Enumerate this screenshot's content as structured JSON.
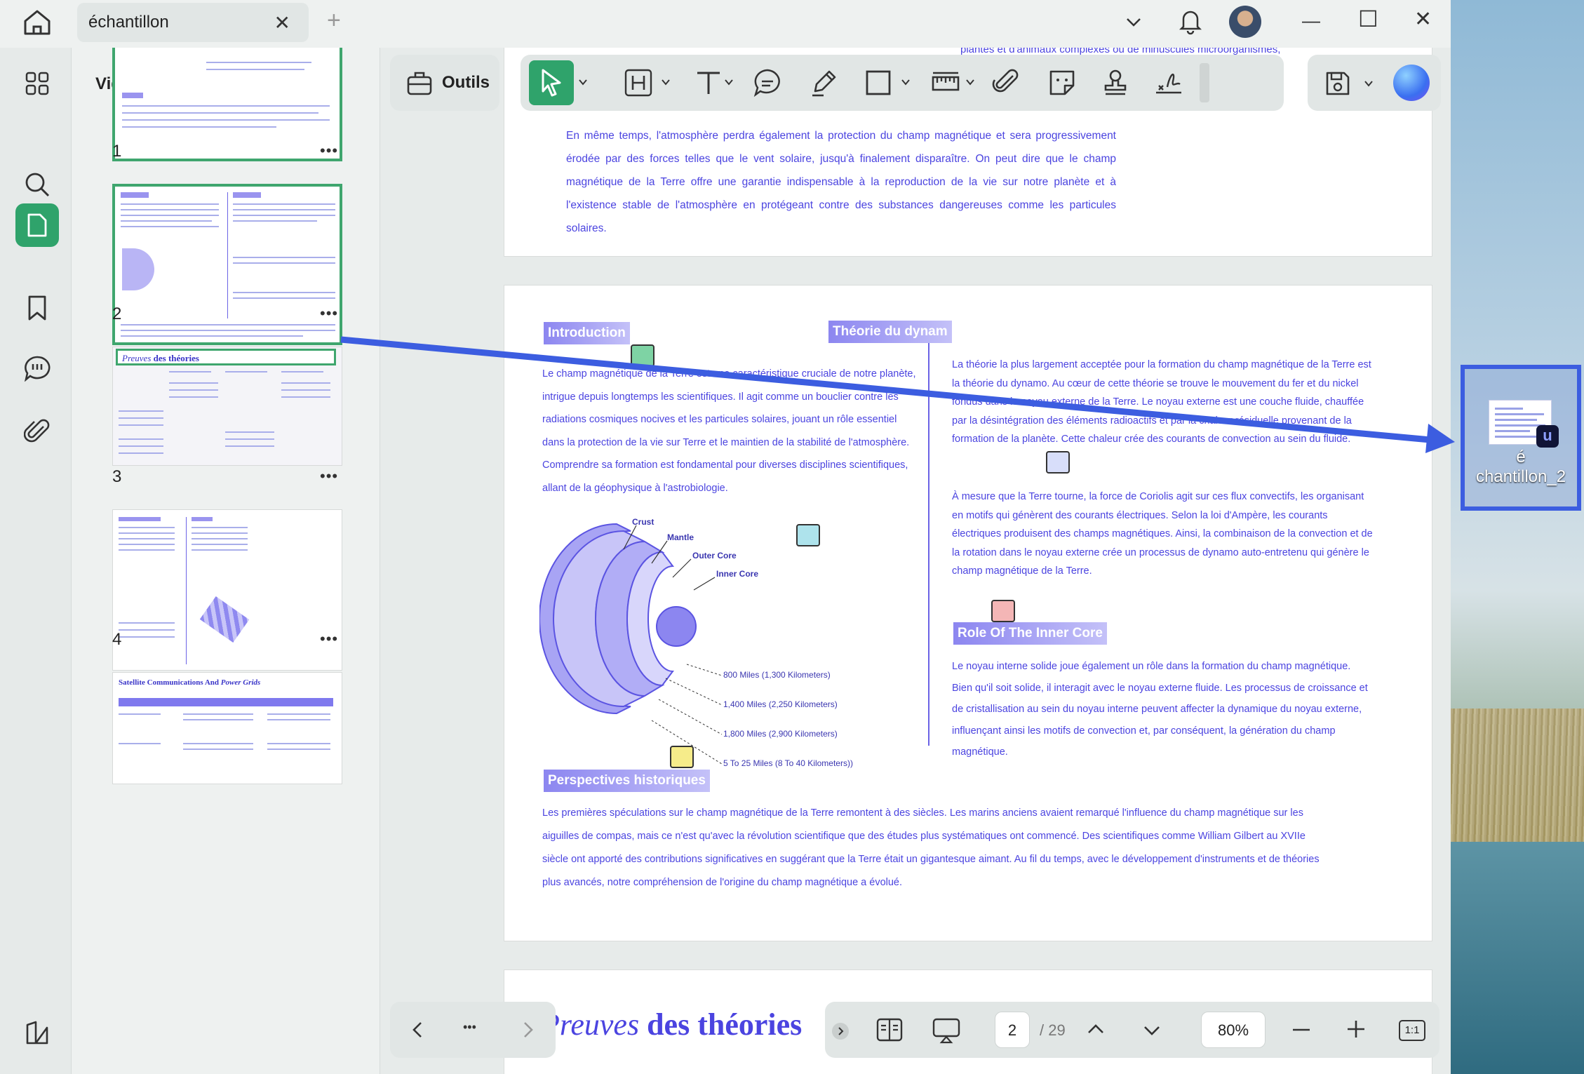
{
  "window": {
    "tab_title": "échantillon",
    "tab_close": "✕",
    "new_tab": "+",
    "controls": {
      "minimize": "—",
      "maximize": "☐",
      "close": "✕"
    }
  },
  "thumbnails": {
    "title": "Vignettes",
    "pages": [
      {
        "number": "1",
        "more": "•••"
      },
      {
        "number": "2",
        "more": "•••"
      },
      {
        "number": "3",
        "more": "•••",
        "heading_italic": "Preuves",
        "heading_rest": " des théories"
      },
      {
        "number": "4",
        "more": "•••"
      },
      {
        "number": "",
        "heading_rest": "Satellite Communications And ",
        "heading_italic": "Power Grids"
      }
    ]
  },
  "toolbar": {
    "tools_label": "Outils"
  },
  "document": {
    "page1_paragraph": "En même temps, l'atmosphère perdra également la protection du champ magnétique et sera progressivement érodée par des forces telles que le vent solaire, jusqu'à finalement disparaître. On peut dire que le champ magnétique de la Terre offre une garantie indispensable à la reproduction de la vie sur notre planète et à l'existence stable de l'atmosphère en protégeant contre des substances dangereuses comme les particules solaires.",
    "page1_top_line": "plantes et d'animaux complexes ou de minuscules microorganismes,",
    "page1_top_fragment": "et",
    "page2": {
      "intro_heading": "Introduction",
      "intro_text": "Le champ magnétique de la Terre est une caractéristique cruciale de notre planète, intrigue depuis longtemps les scientifiques. Il agit comme un bouclier contre les radiations cosmiques nocives et les particules solaires, jouant un rôle essentiel dans la protection de la vie sur Terre et le maintien de la stabilité de l'atmosphère. Comprendre sa formation est fondamental pour diverses disciplines scientifiques, allant de la géophysique à l'astrobiologie.",
      "dynamo_heading": "Théorie du dynam",
      "dynamo_text1": "La théorie la plus largement acceptée pour la formation du champ magnétique de la Terre est la théorie du dynamo. Au cœur de cette théorie se trouve le mouvement du fer et du nickel fondus dans le noyau externe de la Terre. Le noyau externe est une couche fluide, chauffée par la désintégration des éléments radioactifs et par la chaleur résiduelle provenant de la formation de la planète. Cette chaleur crée des courants de convection au sein du fluide.",
      "dynamo_text2": "À mesure que la Terre tourne, la force de Coriolis agit sur ces flux convectifs, les organisant en motifs qui génèrent des courants électriques. Selon la loi d'Ampère, les courants électriques produisent des champs magnétiques. Ainsi, la combinaison de la convection et de la rotation dans le noyau externe crée un processus de dynamo auto-entretenu qui génère le champ magnétique de la Terre.",
      "inner_core_heading": "Role Of The Inner Core",
      "inner_core_text": "Le noyau interne solide joue également un rôle dans la formation du champ magnétique. Bien qu'il soit solide, il interagit avec le noyau externe fluide. Les processus de croissance et de cristallisation au sein du noyau interne peuvent affecter la dynamique du noyau externe, influençant ainsi les motifs de convection et, par conséquent, la génération du champ magnétique.",
      "history_heading": "Perspectives historiques",
      "history_text": "Les premières spéculations sur le champ magnétique de la Terre remontent à des siècles. Les marins anciens avaient remarqué l'influence du champ magnétique sur les aiguilles de compas, mais ce n'est qu'avec la révolution scientifique que des études plus systématiques ont commencé. Des scientifiques comme William Gilbert au XVIIe siècle ont apporté des contributions significatives en suggérant que la Terre était un gigantesque aimant. Au fil du temps, avec le développement d'instruments et de théories plus avancés, notre compréhension de l'origine du champ magnétique a évolué.",
      "diagram": {
        "layers": [
          "Crust",
          "Mantle",
          "Outer Core",
          "Inner Core"
        ],
        "distances": [
          "800 Miles (1,300 Kilometers)",
          "1,400 Miles (2,250 Kilometers)",
          "1,800 Miles (2,900 Kilometers)",
          "5 To 25 Miles (8 To 40 Kilometers))"
        ]
      }
    },
    "page3_heading_italic": "Preuves",
    "page3_heading_rest": " des théories"
  },
  "bottom": {
    "nav_more": "•••",
    "current_page": "2",
    "total_pages": "/ 29",
    "zoom": "80%",
    "zoom_ratio": "1:1"
  },
  "desktop_icon": {
    "label_line1": "é",
    "label_line2": "chantillon_2"
  },
  "colors": {
    "accent_green": "#2fa36b",
    "doc_text": "#4b44e0",
    "drag_arrow": "#3c5de0"
  }
}
